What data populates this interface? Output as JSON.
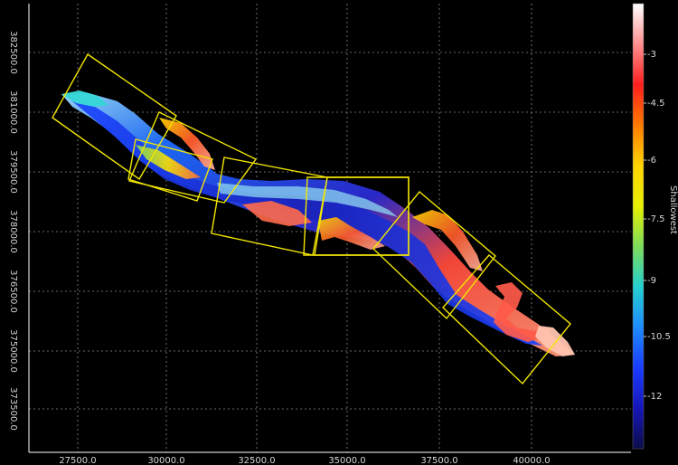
{
  "map": {
    "x_ticks": [
      "27500.0",
      "30000.0",
      "32500.0",
      "35000.0",
      "37500.0",
      "40000.0"
    ],
    "y_ticks": [
      "382500.0",
      "381000.0",
      "379500.0",
      "378000.0",
      "376500.0",
      "375000.0",
      "373500.0"
    ],
    "colors": {
      "background": "#000000",
      "grid": "#8a8a8a",
      "axis_line": "#ffffff",
      "tile_outline": "#f2e600"
    },
    "tile_count": 8
  },
  "colorbar": {
    "title": "Shallowest",
    "labels": [
      "-3",
      "-4.5",
      "-6",
      "-7.5",
      "-9",
      "-10.5",
      "-12"
    ],
    "stops": [
      "#ffffff",
      "#ff9090",
      "#ff1e1e",
      "#ff7a00",
      "#ffd400",
      "#e8f000",
      "#7ddc5a",
      "#25d0d0",
      "#1e8cff",
      "#1a3cff",
      "#1616b8",
      "#0c0c48"
    ]
  }
}
